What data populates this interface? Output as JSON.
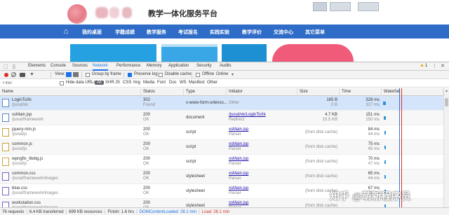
{
  "site": {
    "title": "教学一体化服务平台",
    "nav": [
      {
        "label": "我的桌面"
      },
      {
        "label": "学籍成绩"
      },
      {
        "label": "教学服务"
      },
      {
        "label": "考试报名"
      },
      {
        "label": "实践实验"
      },
      {
        "label": "教学评价"
      },
      {
        "label": "交流中心"
      },
      {
        "label": "其它菜单"
      }
    ],
    "home_icon": "home-icon"
  },
  "devtools": {
    "tabs": [
      {
        "label": "Elements"
      },
      {
        "label": "Console"
      },
      {
        "label": "Sources"
      },
      {
        "label": "Network",
        "active": true
      },
      {
        "label": "Performance"
      },
      {
        "label": "Memory"
      },
      {
        "label": "Application"
      },
      {
        "label": "Security"
      },
      {
        "label": "Audits"
      }
    ],
    "warning_count": "1",
    "toolbar": {
      "view_label": "View:",
      "group_by_frame": "Group by frame",
      "preserve_log": "Preserve log",
      "disable_cache": "Disable cache",
      "offline": "Offline",
      "online": "Online"
    },
    "filter": {
      "placeholder": "Filter",
      "hide_data_urls": "Hide data URLs",
      "types": [
        "All",
        "XHR",
        "JS",
        "CSS",
        "Img",
        "Media",
        "Font",
        "Doc",
        "WS",
        "Manifest",
        "Other"
      ]
    },
    "columns": [
      "Name",
      "Status",
      "Type",
      "Initiator",
      "Size",
      "Time",
      "Waterfall"
    ],
    "rows": [
      {
        "name": "LoginToXk",
        "path": "/jsxsd/xk",
        "status": "302",
        "status_text": "Found",
        "type": "x-www-form-urlenco...",
        "initiator": "Other",
        "initiator_sub": "",
        "size": "165 B",
        "size_sub": "0 B",
        "time": "328 ms",
        "time_sub": "327 ms",
        "icon": "doc",
        "selected": true
      },
      {
        "name": "xsMain.jsp",
        "path": "/jsxsd/framework",
        "status": "200",
        "status_text": "OK",
        "type": "document",
        "initiator": "/jsxsd/xk/LoginToXk",
        "initiator_sub": "Redirect",
        "size": "4.7 KB",
        "size_sub": "15.5 KB",
        "time": "151 ms",
        "time_sub": "150 ms",
        "icon": "doc"
      },
      {
        "name": "jquery-min.js",
        "path": "/jsxsd/js",
        "status": "200",
        "status_text": "OK",
        "type": "script",
        "initiator": "xsMain.jsp",
        "initiator_sub": "Parser",
        "size": "(from disk cache)",
        "size_sub": "",
        "time": "84 ms",
        "time_sub": "44 ms",
        "icon": "js"
      },
      {
        "name": "common.js",
        "path": "/jsxsd/js",
        "status": "200",
        "status_text": "OK",
        "type": "script",
        "initiator": "xsMain.jsp",
        "initiator_sub": "Parser",
        "size": "(from disk cache)",
        "size_sub": "",
        "time": "75 ms",
        "time_sub": "45 ms",
        "icon": "js"
      },
      {
        "name": "iepngfix_tilebg.js",
        "path": "/jsxsd/js",
        "status": "200",
        "status_text": "OK",
        "type": "script",
        "initiator": "xsMain.jsp",
        "initiator_sub": "Parser",
        "size": "(from disk cache)",
        "size_sub": "",
        "time": "70 ms",
        "time_sub": "47 ms",
        "icon": "js"
      },
      {
        "name": "common.css",
        "path": "/jsxsd/framework/images",
        "status": "200",
        "status_text": "OK",
        "type": "stylesheet",
        "initiator": "xsMain.jsp",
        "initiator_sub": "Parser",
        "size": "(from disk cache)",
        "size_sub": "",
        "time": "65 ms",
        "time_sub": "44 ms",
        "icon": "css"
      },
      {
        "name": "blue.css",
        "path": "/jsxsd/framework/images",
        "status": "200",
        "status_text": "OK",
        "type": "stylesheet",
        "initiator": "xsMain.jsp",
        "initiator_sub": "Parser",
        "size": "(from disk cache)",
        "size_sub": "",
        "time": "67 ms",
        "time_sub": "45 ms",
        "icon": "css"
      },
      {
        "name": "workstation.css",
        "path": "/jsxsd/framework/images",
        "status": "200",
        "status_text": "OK",
        "type": "stylesheet",
        "initiator": "xsMain.jsp",
        "initiator_sub": "Parser",
        "size": "(from disk cache)",
        "size_sub": "",
        "time": "",
        "time_sub": "",
        "icon": "css"
      }
    ],
    "status_bar": {
      "requests": "76 requests",
      "transferred": "6.4 KB transferred",
      "resources": "699 KB resources",
      "finish": "Finish: 1.6 hrs",
      "dom_content_loaded": "DOMContentLoaded: 28.1 min",
      "load": "Load: 28.1 min"
    }
  },
  "watermark": "知乎 @萌新程序员",
  "colors": {
    "nav_blue": "#2f6cc7",
    "accent_blue": "#1a73e8",
    "record_red": "#d93025",
    "selected_row": "#d4e5fb"
  }
}
